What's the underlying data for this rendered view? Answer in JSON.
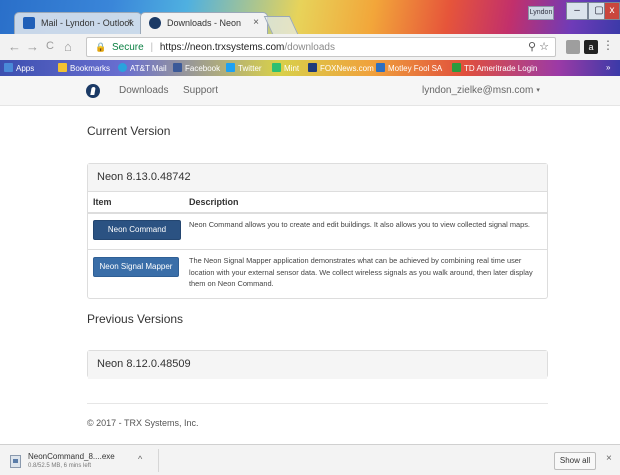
{
  "browser": {
    "tabs": [
      {
        "label": "Mail - Lyndon - Outlook",
        "close": "×",
        "icon_color": "#1f5fb8"
      },
      {
        "label": "Downloads - Neon",
        "close": "×",
        "icon_color": "#1b3a66"
      }
    ],
    "profile_label": "Lyndon",
    "window_buttons": {
      "minimize": "–",
      "maximize": "▢",
      "close": "x"
    },
    "nav": {
      "back": "←",
      "forward": "→",
      "reload": "C",
      "home": "⌂"
    },
    "address": {
      "lock": "🔒",
      "secure_label": "Secure",
      "separator": "|",
      "url_host": "https://neon.trxsystems.com",
      "url_path": "/downloads",
      "icons": "⚲ ☆"
    },
    "extensions": {
      "e2": "a",
      "menu": "⋮"
    },
    "bookmarks": [
      {
        "label": "Apps",
        "color": "#4a8ad8"
      },
      {
        "label": "Bookmarks",
        "color": "#f2c232"
      },
      {
        "label": "AT&T Mail",
        "color": "#29a3dd"
      },
      {
        "label": "Facebook",
        "color": "#3b5998"
      },
      {
        "label": "Twitter",
        "color": "#1da1f2"
      },
      {
        "label": "Mint",
        "color": "#2fbf71"
      },
      {
        "label": "FOXNews.com",
        "color": "#1f3a7a"
      },
      {
        "label": "Motley Fool SA",
        "color": "#2d6fc0"
      },
      {
        "label": "TD Ameritrade Login",
        "color": "#2b9a3e"
      }
    ],
    "bookmarks_more": "»"
  },
  "site_nav": {
    "links": [
      "Downloads",
      "Support"
    ],
    "user_email": "lyndon_zielke@msn.com",
    "user_caret": "▾"
  },
  "current": {
    "heading": "Current Version",
    "version": "Neon 8.13.0.48742",
    "table_headers": {
      "item": "Item",
      "description": "Description"
    },
    "rows": [
      {
        "button": "Neon Command",
        "description": "Neon Command allows you to create and edit buildings. It also allows you to view collected signal maps."
      },
      {
        "button": "Neon Signal Mapper",
        "description": "The Neon Signal Mapper application demonstrates what can be achieved by combining real time user location with your external sensor data. We collect wireless signals as you walk around, then later display them on Neon Command."
      }
    ]
  },
  "previous": {
    "heading": "Previous Versions",
    "version": "Neon 8.12.0.48509"
  },
  "footer": "© 2017 - TRX Systems, Inc.",
  "download_shelf": {
    "file_name": "NeonCommand_8....exe",
    "status": "0.8/52.5 MB, 6 mins left",
    "caret": "^",
    "show_all": "Show all",
    "close": "×"
  }
}
